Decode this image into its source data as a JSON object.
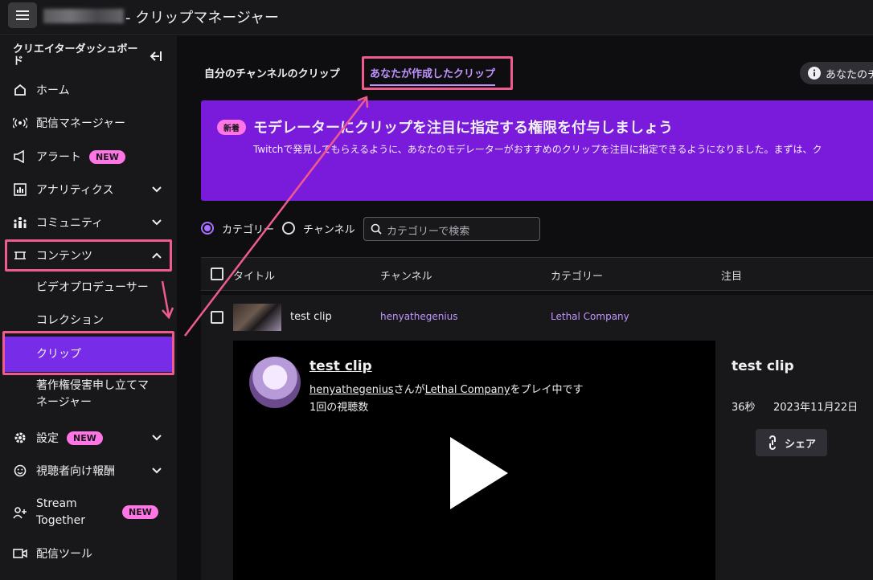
{
  "header": {
    "title": "- クリップマネージャー"
  },
  "sidebar": {
    "title": "クリエイターダッシュボード",
    "items": [
      {
        "label": "ホーム"
      },
      {
        "label": "配信マネージャー"
      },
      {
        "label": "アラート",
        "badge": "NEW"
      },
      {
        "label": "アナリティクス"
      },
      {
        "label": "コミュニティ"
      },
      {
        "label": "コンテンツ"
      },
      {
        "label": "設定",
        "badge": "NEW"
      },
      {
        "label": "視聴者向け報酬"
      },
      {
        "label_line1": "Stream",
        "label_line2": "Together",
        "badge": "NEW"
      },
      {
        "label": "配信ツール"
      }
    ],
    "content_sub": [
      {
        "label": "ビデオプロデューサー"
      },
      {
        "label": "コレクション"
      },
      {
        "label": "クリップ"
      },
      {
        "label_line1": "著作権侵害申し立てマ",
        "label_line2": "ネージャー"
      }
    ]
  },
  "tabs": [
    {
      "label": "自分のチャンネルのクリップ"
    },
    {
      "label": "あなたが作成したクリップ"
    }
  ],
  "info_pill": {
    "label": "あなたのチ"
  },
  "banner": {
    "badge": "新着",
    "title": "モデレーターにクリップを注目に指定する権限を付与しましょう",
    "desc": "Twitchで発見してもらえるように、あなたのモデレーターがおすすめのクリップを注目に指定できるようになりました。まずは、ク"
  },
  "filter": {
    "option_category": "カテゴリー",
    "option_channel": "チャンネル",
    "search_placeholder": "カテゴリーで検索"
  },
  "table": {
    "headers": [
      "タイトル",
      "チャンネル",
      "カテゴリー",
      "注目"
    ],
    "rows": [
      {
        "title": "test clip",
        "channel": "henyathegenius",
        "category": "Lethal Company"
      }
    ]
  },
  "clip_detail": {
    "title": "test clip",
    "channel": "henyathegenius",
    "connector1": "さんが",
    "game": "Lethal Company",
    "connector2": "をプレイ中です",
    "views": "1回の視聴数",
    "side_title": "test clip",
    "duration": "36秒",
    "date": "2023年11月22日",
    "share_label": "シェア"
  },
  "colors": {
    "accent": "#772ce8",
    "highlight": "#ef5b8d",
    "badge": "#ff75e6",
    "link": "#bf94ff"
  }
}
